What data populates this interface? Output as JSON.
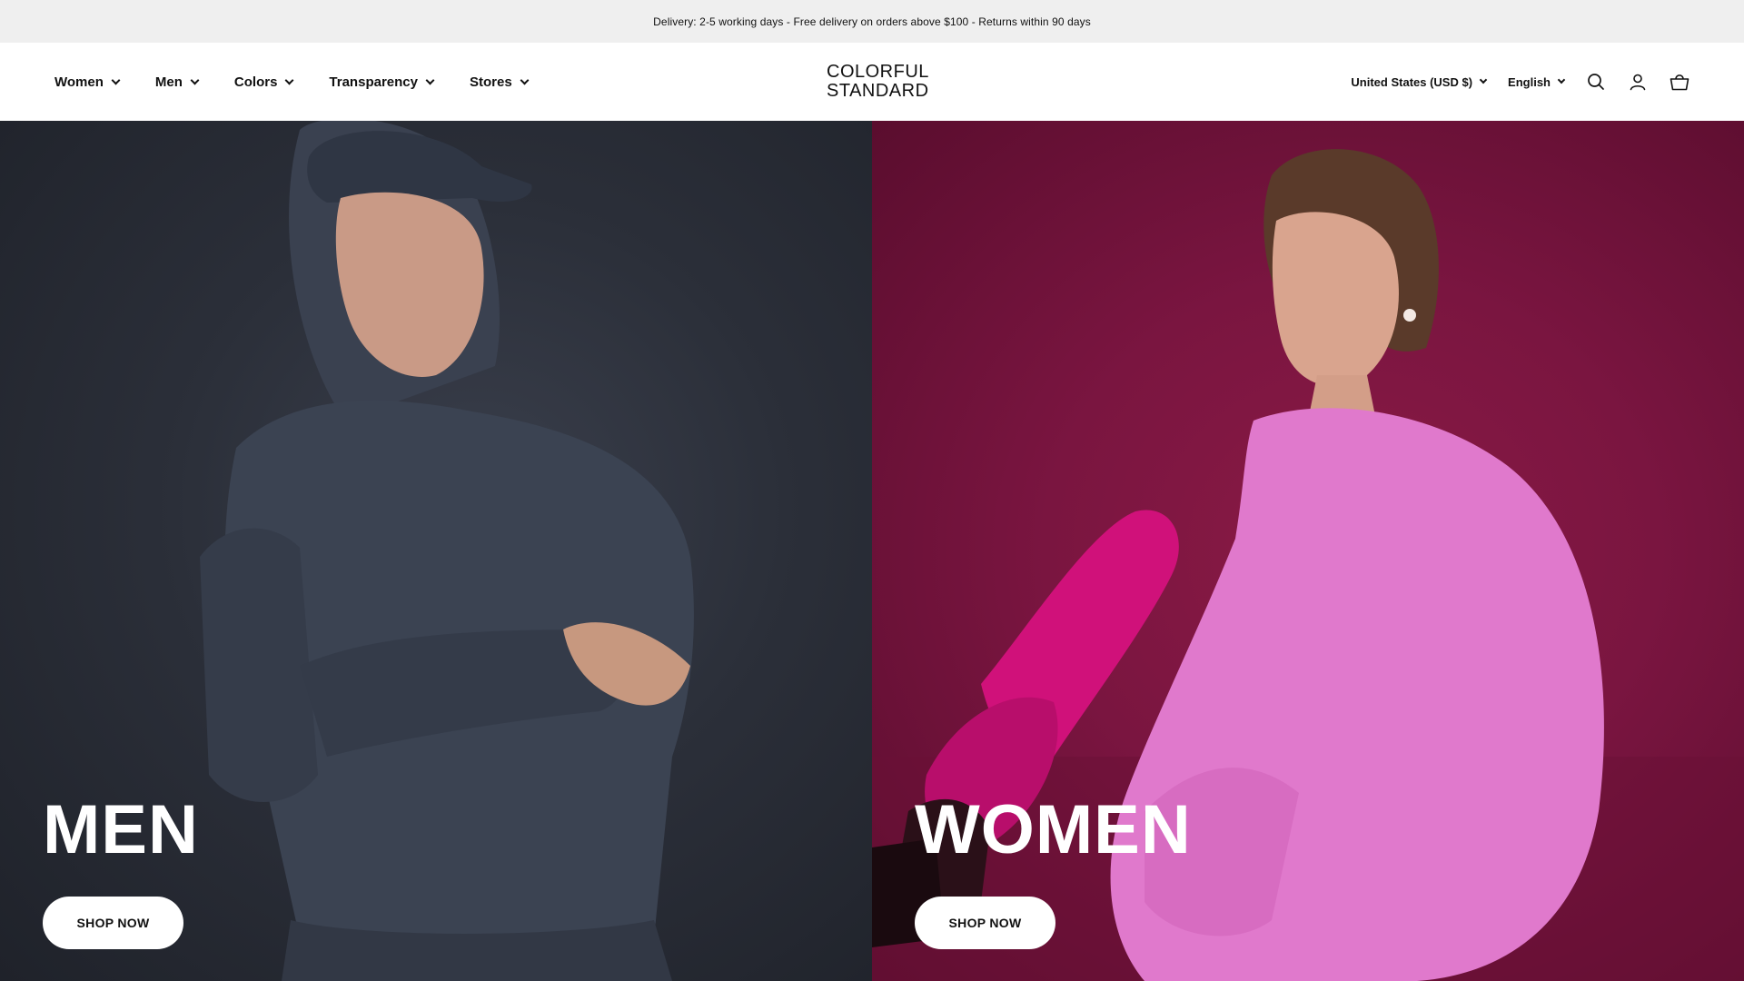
{
  "announcement": {
    "text": "Delivery: 2-5 working days - Free delivery on orders above $100 - Returns within 90 days"
  },
  "header": {
    "nav": [
      {
        "label": "Women"
      },
      {
        "label": "Men"
      },
      {
        "label": "Colors"
      },
      {
        "label": "Transparency"
      },
      {
        "label": "Stores"
      }
    ],
    "logo": {
      "line1": "COLORFUL",
      "line2": "STANDARD"
    },
    "country_selector": "United States (USD $)",
    "language_selector": "English",
    "icons": [
      "search-icon",
      "account-icon",
      "cart-icon"
    ]
  },
  "hero": {
    "men": {
      "title": "MEN",
      "button": "SHOP NOW",
      "bg_color": "#2b2f39"
    },
    "women": {
      "title": "WOMEN",
      "button": "SHOP NOW",
      "bg_color": "#7a1540"
    }
  },
  "colors": {
    "announcement_bg": "#efefef",
    "header_bg": "#ffffff",
    "button_bg": "#ffffff"
  }
}
